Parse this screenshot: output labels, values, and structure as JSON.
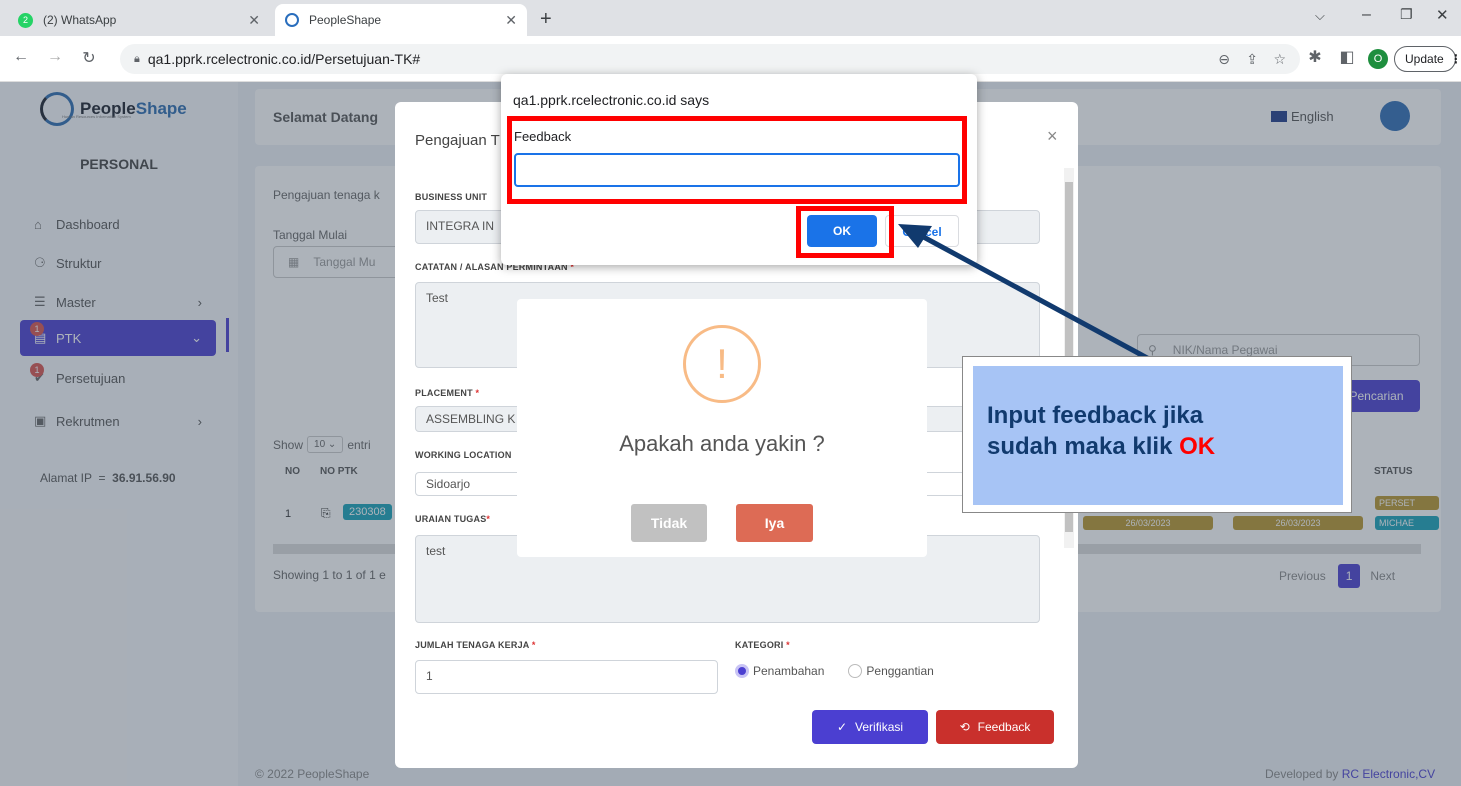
{
  "browser": {
    "tabs": [
      {
        "label": "(2) WhatsApp",
        "badge": "2"
      },
      {
        "label": "PeopleShape"
      }
    ],
    "new_tab": "+",
    "url": "qa1.pprk.rcelectronic.co.id/Persetujuan-TK#",
    "profile_initial": "O",
    "update_label": "Update"
  },
  "app": {
    "logo_people": "People",
    "logo_shape": "Shape",
    "logo_tagline": "Human Resources Information System",
    "section": "PERSONAL",
    "menu": [
      {
        "label": "Dashboard"
      },
      {
        "label": "Struktur"
      },
      {
        "label": "Master"
      },
      {
        "label": "PTK",
        "badge": "1"
      },
      {
        "label": "Persetujuan",
        "badge": "1"
      },
      {
        "label": "Rekrutmen"
      }
    ],
    "ip_label": "Alamat IP  =  ",
    "ip_value": "36.91.56.90",
    "header_title": "Selamat Datang",
    "language": "English",
    "card_title": "Pengajuan tenaga k",
    "start_date_label": "Tanggal Mulai",
    "start_date_placeholder": "Tanggal Mu",
    "search_placeholder": "NIK/Nama Pegawai",
    "search_button": "Pencarian",
    "show_label": "Show",
    "show_value": "10",
    "entries_label": "entri",
    "col_no": "NO",
    "col_no_ptk": "NO PTK",
    "col_status": "STATUS",
    "row_no": "1",
    "row_ptk": "230308",
    "row_date1": "26/03/2023",
    "row_date2": "26/03/2023",
    "row_status1": "PERSET",
    "row_status2": "MICHAE",
    "showing": "Showing 1 to 1 of 1 e",
    "prev": "Previous",
    "page": "1",
    "next": "Next",
    "footer_left": "© 2022 PeopleShape",
    "footer_right_prefix": "Developed by ",
    "footer_right_link": "RC Electronic,CV"
  },
  "modal": {
    "title": "Pengajuan T",
    "business_unit_label": "BUSINESS UNIT",
    "business_unit_value": "INTEGRA IN",
    "catatan_label": "CATATAN / ALASAN PERMINTAAN",
    "catatan_value": "Test",
    "placement_label": "PLACEMENT",
    "placement_value": "ASSEMBLING K",
    "working_location_label": "WORKING LOCATION",
    "working_location_value": "Sidoarjo",
    "uraian_label": "URAIAN TUGAS",
    "uraian_value": "test",
    "jumlah_label": "JUMLAH TENAGA KERJA",
    "jumlah_value": "1",
    "kategori_label": "KATEGORI",
    "kategori_opt1": "Penambahan",
    "kategori_opt2": "Penggantian",
    "verify_button": "Verifikasi",
    "feedback_button": "Feedback"
  },
  "confirm": {
    "icon": "!",
    "message": "Apakah anda yakin ?",
    "cancel": "Tidak",
    "confirm": "Iya"
  },
  "prompt": {
    "site": "qa1.pprk.rcelectronic.co.id says",
    "label": "Feedback",
    "value": "",
    "ok": "OK",
    "cancel": "Cancel"
  },
  "callout": {
    "line1": "Input feedback jika",
    "line2_prefix": "sudah maka klik ",
    "line2_highlight": "OK"
  },
  "colors": {
    "brand": "#4b3fd1",
    "danger": "#d9534f",
    "annotation_red": "#ff0000",
    "callout_bg": "#a7c4f5",
    "arrow": "#113a6e"
  }
}
